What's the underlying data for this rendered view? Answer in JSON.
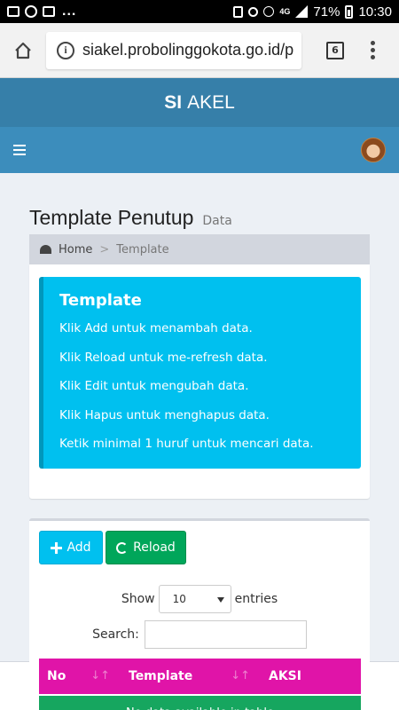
{
  "status_bar": {
    "network": "4G",
    "battery": "71%",
    "time": "10:30",
    "more": "..."
  },
  "browser": {
    "url": "siakel.probolinggokota.go.id/p",
    "tab_count": "6"
  },
  "app": {
    "logo_bold": "SI",
    "logo_rest": "AKEL"
  },
  "page": {
    "title": "Template Penutup",
    "subtitle": "Data"
  },
  "breadcrumb": {
    "home": "Home",
    "separator": ">",
    "current": "Template"
  },
  "callout": {
    "title": "Template",
    "lines": [
      "Klik Add untuk menambah data.",
      "Klik Reload untuk me-refresh data.",
      "Klik Edit untuk mengubah data.",
      "Klik Hapus untuk menghapus data.",
      "Ketik minimal 1 huruf untuk mencari data."
    ]
  },
  "buttons": {
    "add": "Add",
    "reload": "Reload"
  },
  "datatable": {
    "show_label": "Show",
    "page_size": "10",
    "entries_label": "entries",
    "search_label": "Search:",
    "columns": [
      "No",
      "Template",
      "AKSI"
    ],
    "sort_glyph": "↓↑",
    "empty_message": "No data available in table"
  },
  "colors": {
    "header_dark": "#367fa9",
    "header": "#3c8dbc",
    "callout": "#00c0ef",
    "reload_button": "#00a65a",
    "table_header": "#e014a8",
    "table_empty": "#16a65f"
  }
}
